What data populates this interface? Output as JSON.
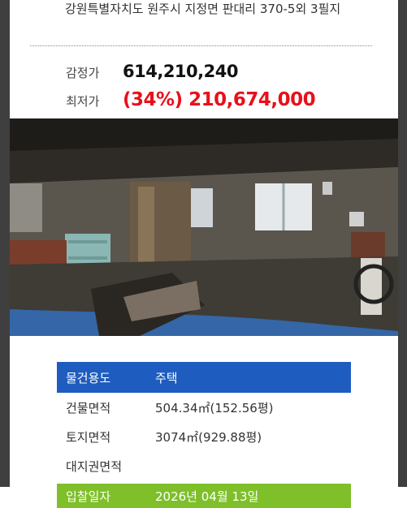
{
  "address": "강원특별자치도 원주시 지정면 판대리 370-5외 3필지",
  "prices": {
    "appraisal_label": "감정가",
    "appraisal_value": "614,210,240",
    "minimum_label": "최저가",
    "minimum_value": "(34%) 210,674,000"
  },
  "photo": {
    "subject": "damaged building interior"
  },
  "info": [
    {
      "key": "물건용도",
      "value": "주택"
    },
    {
      "key": "건물면적",
      "value": "504.34㎡(152.56평)"
    },
    {
      "key": "토지면적",
      "value": "3074㎡(929.88평)"
    },
    {
      "key": "대지권면적",
      "value": ""
    },
    {
      "key": "입찰일자",
      "value": "2026년 04월 13일"
    }
  ],
  "colors": {
    "accent_blue": "#1f5cbf",
    "accent_green": "#7ebf2a",
    "price_red": "#e8101b"
  }
}
